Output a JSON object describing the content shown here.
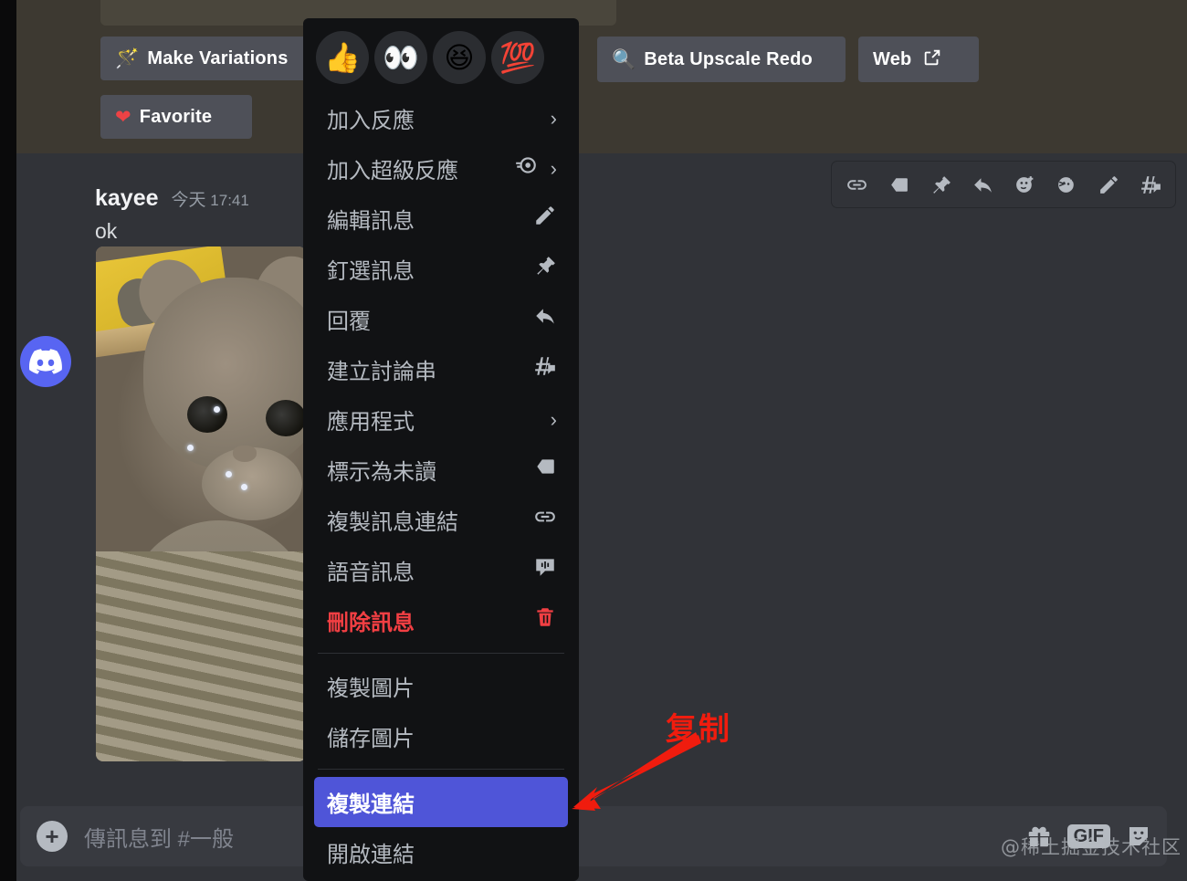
{
  "top_actions": {
    "buttons": [
      {
        "id": "make-variations",
        "label": "Make Variations",
        "icon": "magic-wand-icon",
        "glyph": "🪄"
      },
      {
        "id": "favorite",
        "label": "Favorite",
        "icon": "heart-icon",
        "glyph": "❤"
      },
      {
        "id": "beta-upscale-redo",
        "label": "Beta Upscale Redo",
        "icon": "magnifier-icon",
        "glyph": "🔍"
      },
      {
        "id": "web",
        "label": "Web",
        "icon": "external-link-icon",
        "glyph": "↗"
      }
    ]
  },
  "message": {
    "author": "kayee",
    "timestamp_day": "今天",
    "timestamp_time": "17:41",
    "text": "ok",
    "attachment_alt": "cat-photo"
  },
  "message_toolbar": {
    "icons": [
      "copy-message-link-icon",
      "mark-unread-icon",
      "pin-message-icon",
      "reply-icon",
      "add-reaction-icon",
      "add-super-reaction-icon",
      "edit-message-icon",
      "create-thread-icon"
    ]
  },
  "context_menu": {
    "quick_reactions": [
      {
        "name": "thumbs-up-emoji",
        "glyph": "👍"
      },
      {
        "name": "eyes-emoji",
        "glyph": "👀"
      },
      {
        "name": "grinning-squinting-emoji",
        "glyph": "😆"
      },
      {
        "name": "hundred-points-emoji",
        "glyph": "💯"
      }
    ],
    "items": [
      {
        "label": "加入反應",
        "icon": "chevron-right-icon",
        "type": "submenu"
      },
      {
        "label": "加入超級反應",
        "icon": "super-reaction-icon",
        "type": "submenu"
      },
      {
        "label": "編輯訊息",
        "icon": "pencil-icon",
        "type": "action"
      },
      {
        "label": "釘選訊息",
        "icon": "pin-icon",
        "type": "action"
      },
      {
        "label": "回覆",
        "icon": "reply-arrow-icon",
        "type": "action"
      },
      {
        "label": "建立討論串",
        "icon": "thread-icon",
        "type": "action"
      },
      {
        "label": "應用程式",
        "icon": "chevron-right-icon",
        "type": "submenu"
      },
      {
        "label": "標示為未讀",
        "icon": "mark-unread-icon",
        "type": "action"
      },
      {
        "label": "複製訊息連結",
        "icon": "link-icon",
        "type": "action"
      },
      {
        "label": "語音訊息",
        "icon": "voice-message-icon",
        "type": "action"
      },
      {
        "label": "刪除訊息",
        "icon": "trash-icon",
        "type": "danger"
      },
      {
        "label": "複製圖片",
        "icon": "",
        "type": "action"
      },
      {
        "label": "儲存圖片",
        "icon": "",
        "type": "action"
      },
      {
        "label": "複製連結",
        "icon": "",
        "type": "selected"
      },
      {
        "label": "開啟連結",
        "icon": "",
        "type": "action"
      }
    ]
  },
  "composer": {
    "placeholder": "傳訊息到 #一般",
    "add_label": "+",
    "gif_label": "GIF",
    "icons": [
      "gift-icon",
      "gif-icon",
      "sticker-icon"
    ]
  },
  "annotation": {
    "text": "复制",
    "color": "#f01c0e",
    "arrow": "arrow-pointing-to-copy-link"
  },
  "watermark": {
    "text": "@稀土掘金技术社区"
  },
  "colors": {
    "menu_bg": "#111214",
    "selected_bg": "#4f55d8",
    "danger": "#f23f43",
    "chat_bg": "#313338",
    "hover_bg": "#3d3931",
    "brand": "#5865f2"
  }
}
